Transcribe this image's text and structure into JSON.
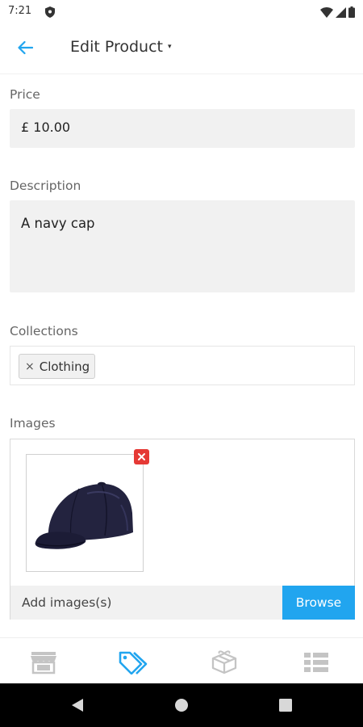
{
  "status_bar": {
    "time": "7:21",
    "icons": [
      "shield-icon",
      "wifi-icon",
      "signal-icon",
      "battery-icon"
    ]
  },
  "app_bar": {
    "title": "Edit Product",
    "back_icon": "arrow-left-icon",
    "title_caret": "▾",
    "accent_color": "#21a5ef"
  },
  "form": {
    "price": {
      "label": "Price",
      "value": "£ 10.00"
    },
    "description": {
      "label": "Description",
      "value": "A navy cap"
    },
    "collections": {
      "label": "Collections",
      "chips": [
        {
          "remove": "×",
          "label": "Clothing"
        }
      ]
    },
    "images": {
      "label": "Images",
      "items": [
        {
          "alt": "navy cap",
          "remove_icon": "close-icon"
        }
      ],
      "add_placeholder": "Add images(s)",
      "browse_label": "Browse",
      "browse_color": "#21a5ef"
    }
  },
  "bottom_nav": {
    "items": [
      {
        "icon": "store-icon",
        "active": false
      },
      {
        "icon": "tags-icon",
        "active": true
      },
      {
        "icon": "gift-icon",
        "active": false
      },
      {
        "icon": "list-icon",
        "active": false
      }
    ],
    "active_color": "#21a5ef",
    "inactive_color": "#c4c4c4"
  },
  "system_nav": {
    "icons": [
      "back-triangle-icon",
      "home-circle-icon",
      "recents-square-icon"
    ]
  }
}
